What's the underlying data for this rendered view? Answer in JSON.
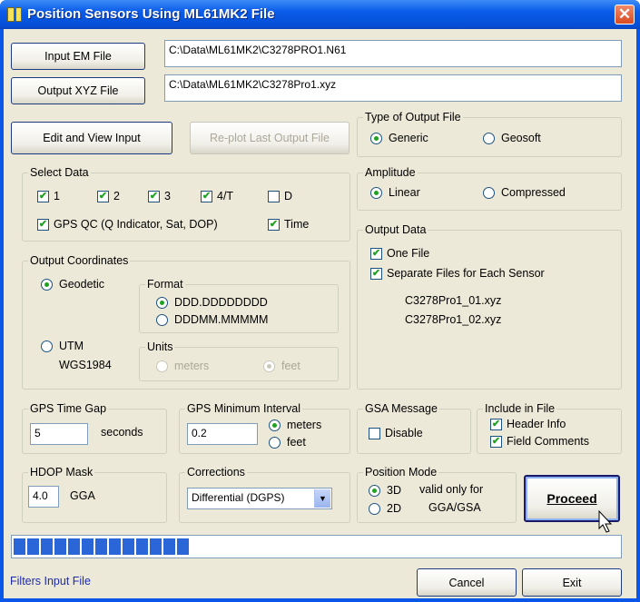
{
  "window": {
    "title": "Position Sensors Using ML61MK2 File"
  },
  "files": {
    "input_button": "Input EM File",
    "input_path": "C:\\Data\\ML61MK2\\C3278PRO1.N61",
    "output_button": "Output XYZ File",
    "output_path": "C:\\Data\\ML61MK2\\C3278Pro1.xyz"
  },
  "actions": {
    "edit_view": "Edit and View Input",
    "replot": "Re-plot Last Output File",
    "proceed": "Proceed",
    "cancel": "Cancel",
    "exit": "Exit"
  },
  "type_output": {
    "label": "Type of Output File",
    "generic": "Generic",
    "geosoft": "Geosoft",
    "selected": "Generic"
  },
  "select_data": {
    "label": "Select Data",
    "items": [
      {
        "label": "1",
        "checked": true
      },
      {
        "label": "2",
        "checked": true
      },
      {
        "label": "3",
        "checked": true
      },
      {
        "label": "4/T",
        "checked": true
      },
      {
        "label": "D",
        "checked": false
      }
    ],
    "gps_qc": "GPS QC (Q Indicator, Sat, DOP)",
    "time": "Time"
  },
  "amplitude": {
    "label": "Amplitude",
    "linear": "Linear",
    "compressed": "Compressed",
    "selected": "Linear"
  },
  "output_data": {
    "label": "Output Data",
    "one_file": "One File",
    "separate": "Separate Files for Each Sensor",
    "files": [
      "C3278Pro1_01.xyz",
      "C3278Pro1_02.xyz"
    ]
  },
  "output_coords": {
    "label": "Output Coordinates",
    "geodetic": "Geodetic",
    "utm": "UTM",
    "datum": "WGS1984",
    "format_label": "Format",
    "format_opts": [
      "DDD.DDDDDDDD",
      "DDDMM.MMMMM"
    ],
    "units_label": "Units",
    "units_opts": [
      "meters",
      "feet"
    ]
  },
  "gps_gap": {
    "label": "GPS Time Gap",
    "value": "5",
    "unit": "seconds"
  },
  "gps_min": {
    "label": "GPS Minimum Interval",
    "value": "0.2",
    "meters": "meters",
    "feet": "feet"
  },
  "gsa": {
    "label": "GSA Message",
    "disable": "Disable"
  },
  "include": {
    "label": "Include in File",
    "header": "Header Info",
    "comments": "Field Comments"
  },
  "hdop": {
    "label": "HDOP Mask",
    "value": "4.0",
    "suffix": "GGA"
  },
  "corrections": {
    "label": "Corrections",
    "value": "Differential (DGPS)"
  },
  "position_mode": {
    "label": "Position Mode",
    "opt3d": "3D",
    "opt2d": "2D",
    "note1": "valid only for",
    "note2": "GGA/GSA"
  },
  "progress": {
    "segments_filled": 13,
    "fraction": 0.29
  },
  "status": {
    "text": "Filters Input File"
  },
  "colors": {
    "title_bar": "#0a5be8",
    "progress_fill": "#2a66d8",
    "status_text": "#1e2bb0"
  }
}
